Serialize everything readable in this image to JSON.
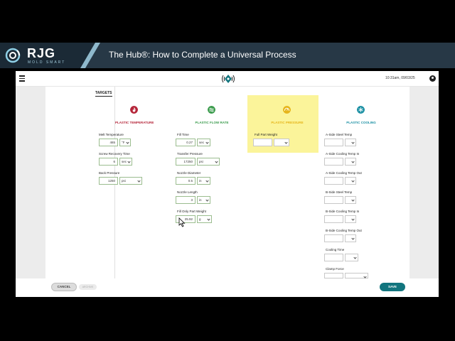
{
  "banner": {
    "brand": "RJG",
    "brand_sub": "MOLD SMART",
    "title": "The Hub®: How to Complete a Universal Process"
  },
  "header": {
    "time": "10:31am, 09/03/25"
  },
  "section_label": "TARGETS",
  "columns": {
    "temperature": {
      "label": "PLASTIC TEMPERATURE",
      "icon": "flame-icon",
      "color": "#b5263a",
      "fields": [
        {
          "label": "Melt Temperature",
          "value": "465",
          "unit": "°F"
        },
        {
          "label": "Screw Recovery Time",
          "value": "6",
          "unit": "sec"
        },
        {
          "label": "Back Pressure",
          "value": "1250",
          "unit": "psi"
        }
      ]
    },
    "flow": {
      "label": "PLASTIC FLOW RATE",
      "icon": "flow-icon",
      "color": "#3a9b4c",
      "fields": [
        {
          "label": "Fill Time",
          "value": "0.27",
          "unit": "sec"
        },
        {
          "label": "Transfer Pressure",
          "value": "17250",
          "unit": "psi"
        },
        {
          "label": "Nozzle Diameter",
          "value": "0.5",
          "unit": "in"
        },
        {
          "label": "Nozzle Length",
          "value": "3",
          "unit": "in"
        },
        {
          "label": "Fill Only Part Weight",
          "value": "25.92",
          "unit": "g"
        }
      ]
    },
    "pressure": {
      "label": "PLASTIC PRESSURE",
      "icon": "gauge-icon",
      "color": "#e6b51b",
      "fields": [
        {
          "label": "Full Part Weight",
          "value": "",
          "unit": ""
        }
      ]
    },
    "cooling": {
      "label": "PLASTIC COOLING",
      "icon": "snowflake-icon",
      "color": "#1a8fa3",
      "fields": [
        {
          "label": "A-Side Steel Temp",
          "value": "",
          "unit": ""
        },
        {
          "label": "A-Side Cooling Temp In",
          "value": "",
          "unit": ""
        },
        {
          "label": "A-Side Cooling Temp Out",
          "value": "",
          "unit": ""
        },
        {
          "label": "B-Side Steel Temp",
          "value": "",
          "unit": ""
        },
        {
          "label": "B-Side Cooling Temp In",
          "value": "",
          "unit": ""
        },
        {
          "label": "B-Side Cooling Temp Out",
          "value": "",
          "unit": ""
        },
        {
          "label": "Cooling Time",
          "value": "",
          "unit": ""
        },
        {
          "label": "Clamp Force",
          "value": "",
          "unit": ""
        }
      ]
    }
  },
  "footer": {
    "cancel_label": "CANCEL",
    "archive_label": "ARCHIVE",
    "save_label": "SAVE"
  },
  "colors": {
    "banner_bg": "#273846",
    "accent_teal": "#12757e",
    "pressure_highlight": "#fbf49a"
  }
}
